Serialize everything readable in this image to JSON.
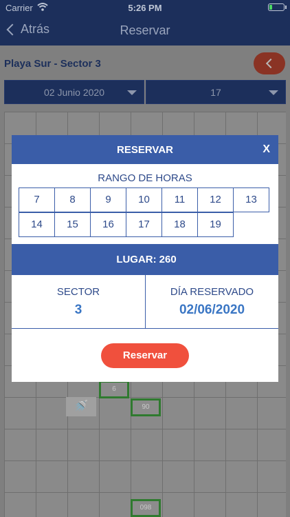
{
  "status_bar": {
    "carrier": "Carrier",
    "time": "5:26 PM"
  },
  "nav": {
    "back_label": "Atrás",
    "title": "Reservar"
  },
  "background": {
    "place_title": "Playa Sur - Sector 3",
    "date_dropdown": "02 Junio 2020",
    "hour_dropdown": "17",
    "spot_labels": [
      "6",
      "90",
      "098"
    ]
  },
  "modal": {
    "title": "RESERVAR",
    "close_label": "X",
    "range_label": "RANGO DE HORAS",
    "hours_row1": [
      "7",
      "8",
      "9",
      "10",
      "11",
      "12",
      "13"
    ],
    "hours_row2": [
      "14",
      "15",
      "16",
      "17",
      "18",
      "19"
    ],
    "lugar_label": "LUGAR:",
    "lugar_value": "260",
    "sector_label": "SECTOR",
    "sector_value": "3",
    "day_label": "DÍA RESERVADO",
    "day_value": "02/06/2020",
    "reserve_button": "Reservar"
  },
  "colors": {
    "nav_bg": "#1c2f5b",
    "modal_blue": "#3a5da8",
    "value_blue": "#3a76c4",
    "button_red": "#f0503d"
  }
}
